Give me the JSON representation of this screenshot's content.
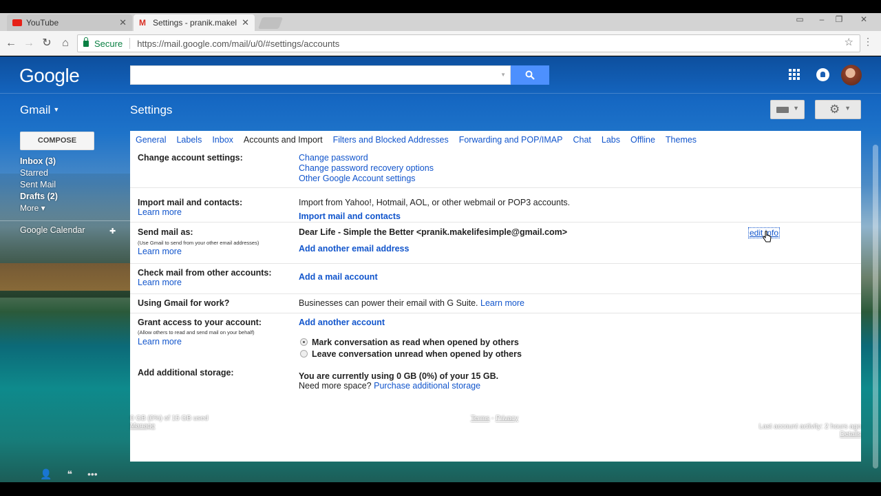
{
  "browser": {
    "tabs": [
      {
        "title": "YouTube",
        "favicon_color": "#e62117"
      },
      {
        "title": "Settings - pranik.makelife",
        "favicon_color": "#d93025"
      }
    ],
    "secure_label": "Secure",
    "url": "https://mail.google.com/mail/u/0/#settings/accounts"
  },
  "header": {
    "logo": "Google",
    "search_button_icon": "search-icon",
    "apps_icon": "apps-grid-icon",
    "notifications_icon": "bell-icon"
  },
  "toolbar": {
    "gmail_label": "Gmail",
    "page_title": "Settings"
  },
  "sidebar": {
    "compose": "COMPOSE",
    "items": [
      {
        "label": "Inbox (3)",
        "bold": true
      },
      {
        "label": "Starred",
        "bold": false
      },
      {
        "label": "Sent Mail",
        "bold": false
      },
      {
        "label": "Drafts (2)",
        "bold": true
      },
      {
        "label": "More ▾",
        "bold": false
      }
    ],
    "calendar": "Google Calendar"
  },
  "settings": {
    "tabs": [
      "General",
      "Labels",
      "Inbox",
      "Accounts and Import",
      "Filters and Blocked Addresses",
      "Forwarding and POP/IMAP",
      "Chat",
      "Labs",
      "Offline",
      "Themes"
    ],
    "active_tab": "Accounts and Import",
    "change_account": {
      "label": "Change account settings:",
      "links": [
        "Change password",
        "Change password recovery options",
        "Other Google Account settings"
      ]
    },
    "import": {
      "label": "Import mail and contacts:",
      "learn_more": "Learn more",
      "text": "Import from Yahoo!, Hotmail, AOL, or other webmail or POP3 accounts.",
      "action": "Import mail and contacts"
    },
    "send_as": {
      "label": "Send mail as:",
      "sub": "(Use Gmail to send from your other email addresses)",
      "learn_more": "Learn more",
      "identity": "Dear Life - Simple the Better <pranik.makelifesimple@gmail.com>",
      "edit": "edit info",
      "action": "Add another email address"
    },
    "check_mail": {
      "label": "Check mail from other accounts:",
      "learn_more": "Learn more",
      "action": "Add a mail account"
    },
    "work": {
      "label": "Using Gmail for work?",
      "text": "Businesses can power their email with G Suite.",
      "learn_more": "Learn more"
    },
    "grant": {
      "label": "Grant access to your account:",
      "sub": "(Allow others to read and send mail on your behalf)",
      "learn_more": "Learn more",
      "action": "Add another account",
      "option_read": "Mark conversation as read when opened by others",
      "option_unread": "Leave conversation unread when opened by others"
    },
    "storage": {
      "label": "Add additional storage:",
      "usage": "You are currently using 0 GB (0%) of your 15 GB.",
      "need": "Need more space?",
      "purchase": "Purchase additional storage"
    }
  },
  "footer": {
    "usage": "0 GB (0%) of 15 GB used",
    "manage": "Manage",
    "terms": "Terms",
    "dash": "-",
    "privacy": "Privacy",
    "activity": "Last account activity: 2 hours ago",
    "details": "Details"
  }
}
